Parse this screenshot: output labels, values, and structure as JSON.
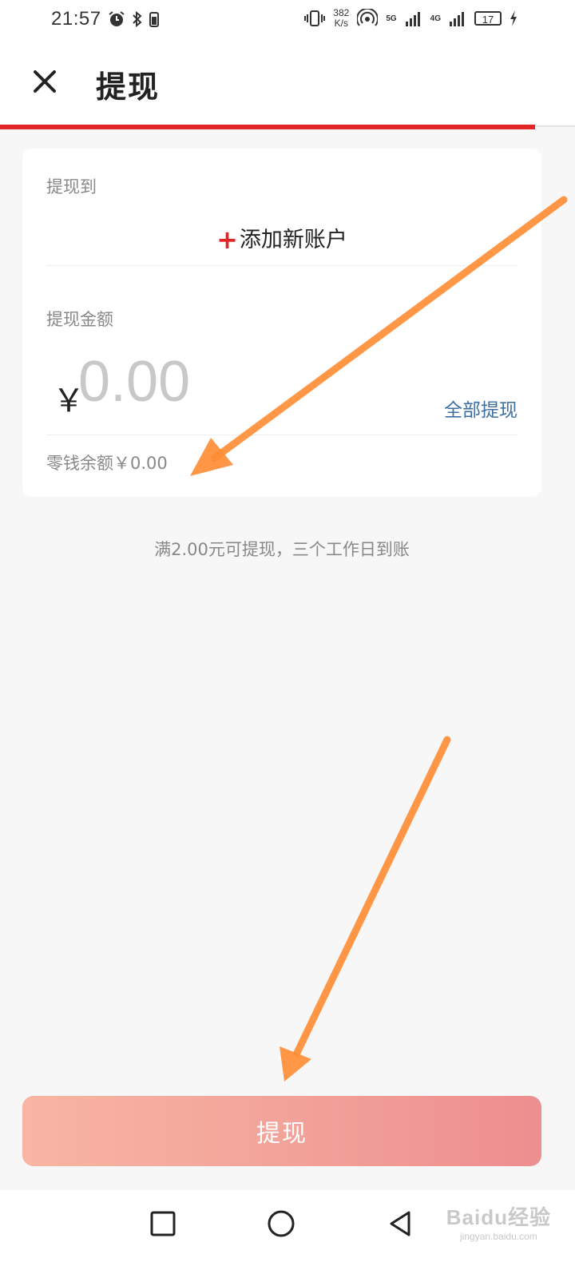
{
  "status_bar": {
    "time": "21:57",
    "net_speed_value": "382",
    "net_speed_unit": "K/s",
    "sim1_net": "5G",
    "sim2_net": "4G",
    "battery_level": "17",
    "icons": [
      "alarm-icon",
      "bluetooth-icon",
      "vibrate-icon",
      "hotspot-icon",
      "signal-icon",
      "battery-icon",
      "charging-icon"
    ]
  },
  "header": {
    "title": "提现",
    "close_icon": "close-icon"
  },
  "form": {
    "to_label": "提现到",
    "add_account_label": "添加新账户",
    "amount_label": "提现金额",
    "currency_symbol": "￥",
    "amount_placeholder": "0.00",
    "withdraw_all_label": "全部提现",
    "balance_text": "零钱余额￥0.00"
  },
  "hint_text": "满2.00元可提现，三个工作日到账",
  "submit_label": "提现",
  "nav": {
    "icons": [
      "recent-apps-icon",
      "home-icon",
      "back-icon"
    ]
  },
  "watermark": {
    "main": "Baidu经验",
    "sub": "jingyan.baidu.com"
  },
  "colors": {
    "accent_red": "#e02626",
    "link_blue": "#3d6fa0",
    "button_gradient_start": "#f9b5a3",
    "button_gradient_end": "#ed8e8f",
    "annotation_arrow": "#ff8c33"
  }
}
